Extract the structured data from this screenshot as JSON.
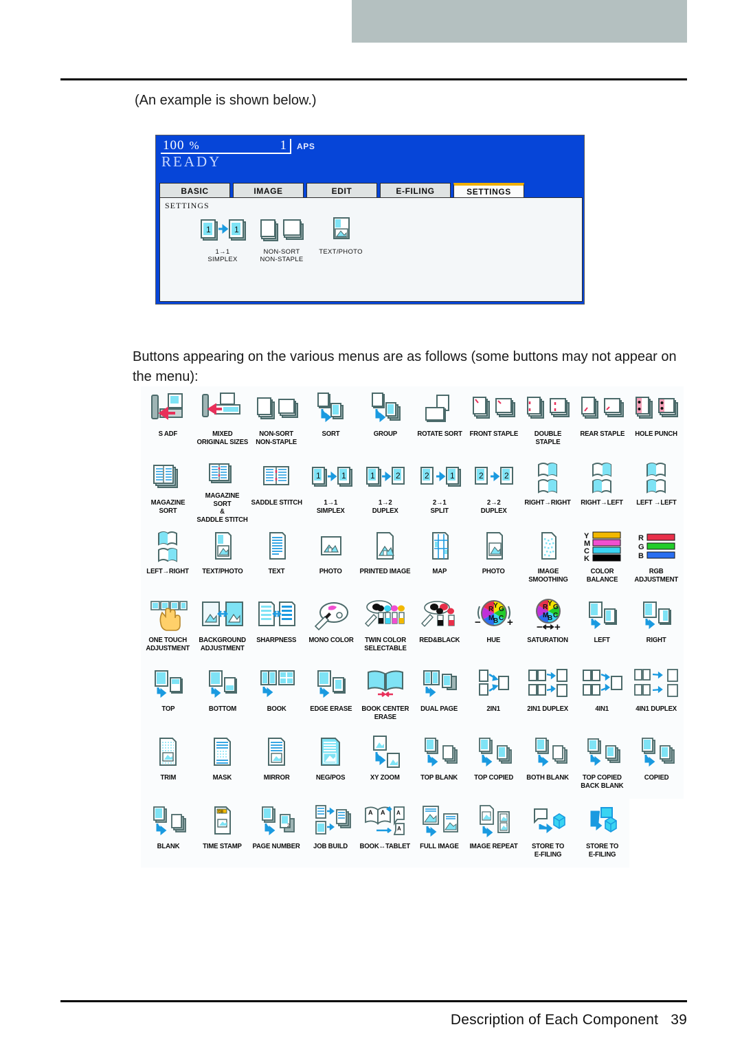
{
  "document": {
    "intro_line": "(An example is shown below.)",
    "body_paragraph": "Buttons appearing on the various menus are as follows (some buttons may not appear on the menu):",
    "footer_title": "Description of Each Component",
    "footer_page": "39",
    "footer_combined": "Description of Each Component   39"
  },
  "lcd_panel": {
    "zoom_ratio": "100",
    "percent_symbol": "%",
    "copy_count": "1",
    "paper_mode": "APS",
    "status": "READY",
    "tabs": [
      {
        "label": "BASIC",
        "active": false
      },
      {
        "label": "IMAGE",
        "active": false
      },
      {
        "label": "EDIT",
        "active": false
      },
      {
        "label": "E-FILING",
        "active": false
      },
      {
        "label": "SETTINGS",
        "active": true
      }
    ],
    "body_title": "SETTINGS",
    "settings_items": [
      {
        "icon": "simplex-icon",
        "label": "1→1\nSIMPLEX"
      },
      {
        "icon": "non-sort-non-staple-icon",
        "label": "NON-SORT\nNON-STAPLE"
      },
      {
        "icon": "text-photo-icon",
        "label": "TEXT/PHOTO"
      }
    ],
    "colors": {
      "screen_blue": "#0645d8",
      "active_tab_accent": "#f0b000",
      "tab_face": "#dfe3e3",
      "body_face": "#f4f7f9"
    }
  },
  "icon_grid": {
    "columns": 10,
    "rows": [
      [
        {
          "icon": "s-adf-icon",
          "label": "S ADF"
        },
        {
          "icon": "mixed-original-sizes-icon",
          "label": "MIXED\nORIGINAL SIZES"
        },
        {
          "icon": "non-sort-non-staple-icon",
          "label": "NON-SORT\nNON-STAPLE"
        },
        {
          "icon": "sort-icon",
          "label": "SORT"
        },
        {
          "icon": "group-icon",
          "label": "GROUP"
        },
        {
          "icon": "rotate-sort-icon",
          "label": "ROTATE SORT"
        },
        {
          "icon": "front-staple-icon",
          "label": "FRONT STAPLE"
        },
        {
          "icon": "double-staple-icon",
          "label": "DOUBLE STAPLE"
        },
        {
          "icon": "rear-staple-icon",
          "label": "REAR STAPLE"
        },
        {
          "icon": "hole-punch-icon",
          "label": "HOLE PUNCH"
        }
      ],
      [
        {
          "icon": "magazine-sort-icon",
          "label": "MAGAZINE SORT"
        },
        {
          "icon": "magazine-sort-saddle-stitch-icon",
          "label": "MAGAZINE SORT\n&\nSADDLE STITCH"
        },
        {
          "icon": "saddle-stitch-icon",
          "label": "SADDLE STITCH"
        },
        {
          "icon": "simplex-icon",
          "label": "1→1\nSIMPLEX"
        },
        {
          "icon": "duplex-1-2-icon",
          "label": "1→2\nDUPLEX"
        },
        {
          "icon": "split-2-1-icon",
          "label": "2→1\nSPLIT"
        },
        {
          "icon": "duplex-2-2-icon",
          "label": "2→2\nDUPLEX"
        },
        {
          "icon": "right-to-right-icon",
          "label": "RIGHT→RIGHT"
        },
        {
          "icon": "right-to-left-icon",
          "label": "RIGHT→LEFT"
        },
        {
          "icon": "left-to-left-icon",
          "label": "LEFT →LEFT"
        }
      ],
      [
        {
          "icon": "left-to-right-icon",
          "label": "LEFT→RIGHT"
        },
        {
          "icon": "text-photo-icon",
          "label": "TEXT/PHOTO"
        },
        {
          "icon": "text-icon",
          "label": "TEXT"
        },
        {
          "icon": "photo-icon",
          "label": "PHOTO"
        },
        {
          "icon": "printed-image-icon",
          "label": "PRINTED IMAGE"
        },
        {
          "icon": "map-icon",
          "label": "MAP"
        },
        {
          "icon": "photo-alt-icon",
          "label": "PHOTO"
        },
        {
          "icon": "image-smoothing-icon",
          "label": "IMAGE\nSMOOTHING"
        },
        {
          "icon": "color-balance-icon",
          "label": "COLOR BALANCE"
        },
        {
          "icon": "rgb-adjustment-icon",
          "label": "RGB\nADJUSTMENT"
        }
      ],
      [
        {
          "icon": "one-touch-adjustment-icon",
          "label": "ONE TOUCH\nADJUSTMENT"
        },
        {
          "icon": "background-adjustment-icon",
          "label": "BACKGROUND\nADJUSTMENT"
        },
        {
          "icon": "sharpness-icon",
          "label": "SHARPNESS"
        },
        {
          "icon": "mono-color-icon",
          "label": "MONO COLOR"
        },
        {
          "icon": "twin-color-selectable-icon",
          "label": "TWIN COLOR\nSELECTABLE"
        },
        {
          "icon": "red-and-black-icon",
          "label": "RED&BLACK"
        },
        {
          "icon": "hue-icon",
          "label": "HUE"
        },
        {
          "icon": "saturation-icon",
          "label": "SATURATION"
        },
        {
          "icon": "left-icon",
          "label": "LEFT"
        },
        {
          "icon": "right-icon",
          "label": "RIGHT"
        }
      ],
      [
        {
          "icon": "top-icon",
          "label": "TOP"
        },
        {
          "icon": "bottom-icon",
          "label": "BOTTOM"
        },
        {
          "icon": "book-icon",
          "label": "BOOK"
        },
        {
          "icon": "edge-erase-icon",
          "label": "EDGE ERASE"
        },
        {
          "icon": "book-center-erase-icon",
          "label": "BOOK CENTER\nERASE"
        },
        {
          "icon": "dual-page-icon",
          "label": "DUAL PAGE"
        },
        {
          "icon": "2in1-icon",
          "label": "2IN1"
        },
        {
          "icon": "2in1-duplex-icon",
          "label": "2IN1 DUPLEX"
        },
        {
          "icon": "4in1-icon",
          "label": "4IN1"
        },
        {
          "icon": "4in1-duplex-icon",
          "label": "4IN1 DUPLEX"
        }
      ],
      [
        {
          "icon": "trim-icon",
          "label": "TRIM"
        },
        {
          "icon": "mask-icon",
          "label": "MASK"
        },
        {
          "icon": "mirror-icon",
          "label": "MIRROR"
        },
        {
          "icon": "neg-pos-icon",
          "label": "NEG/POS"
        },
        {
          "icon": "xy-zoom-icon",
          "label": "XY ZOOM"
        },
        {
          "icon": "top-blank-icon",
          "label": "TOP BLANK"
        },
        {
          "icon": "top-copied-icon",
          "label": "TOP COPIED"
        },
        {
          "icon": "both-blank-icon",
          "label": "BOTH BLANK"
        },
        {
          "icon": "top-copied-back-blank-icon",
          "label": "TOP COPIED\nBACK BLANK"
        },
        {
          "icon": "copied-icon",
          "label": "COPIED"
        }
      ],
      [
        {
          "icon": "blank-icon",
          "label": "BLANK"
        },
        {
          "icon": "time-stamp-icon",
          "label": "TIME STAMP"
        },
        {
          "icon": "page-number-icon",
          "label": "PAGE NUMBER"
        },
        {
          "icon": "job-build-icon",
          "label": "JOB BUILD"
        },
        {
          "icon": "book-tablet-icon",
          "label": "BOOK↔TABLET"
        },
        {
          "icon": "full-image-icon",
          "label": "FULL IMAGE"
        },
        {
          "icon": "image-repeat-icon",
          "label": "IMAGE REPEAT"
        },
        {
          "icon": "store-to-e-filing-icon",
          "label": "STORE TO\nE-FILING"
        },
        {
          "icon": "store-to-e-filing-alt-icon",
          "label": "STORE TO\nE-FILING"
        },
        {
          "icon": "empty-cell",
          "label": ""
        }
      ]
    ]
  },
  "colors": {
    "band_gray": "#b4c0c0",
    "rule_black": "#000000",
    "icon_outline": "#4b6a6a",
    "icon_fill_cyan": "#7fe3f5",
    "icon_shadow": "#8fa8a8",
    "accent_blue": "#1a9ae0",
    "accent_red": "#e8305a"
  }
}
